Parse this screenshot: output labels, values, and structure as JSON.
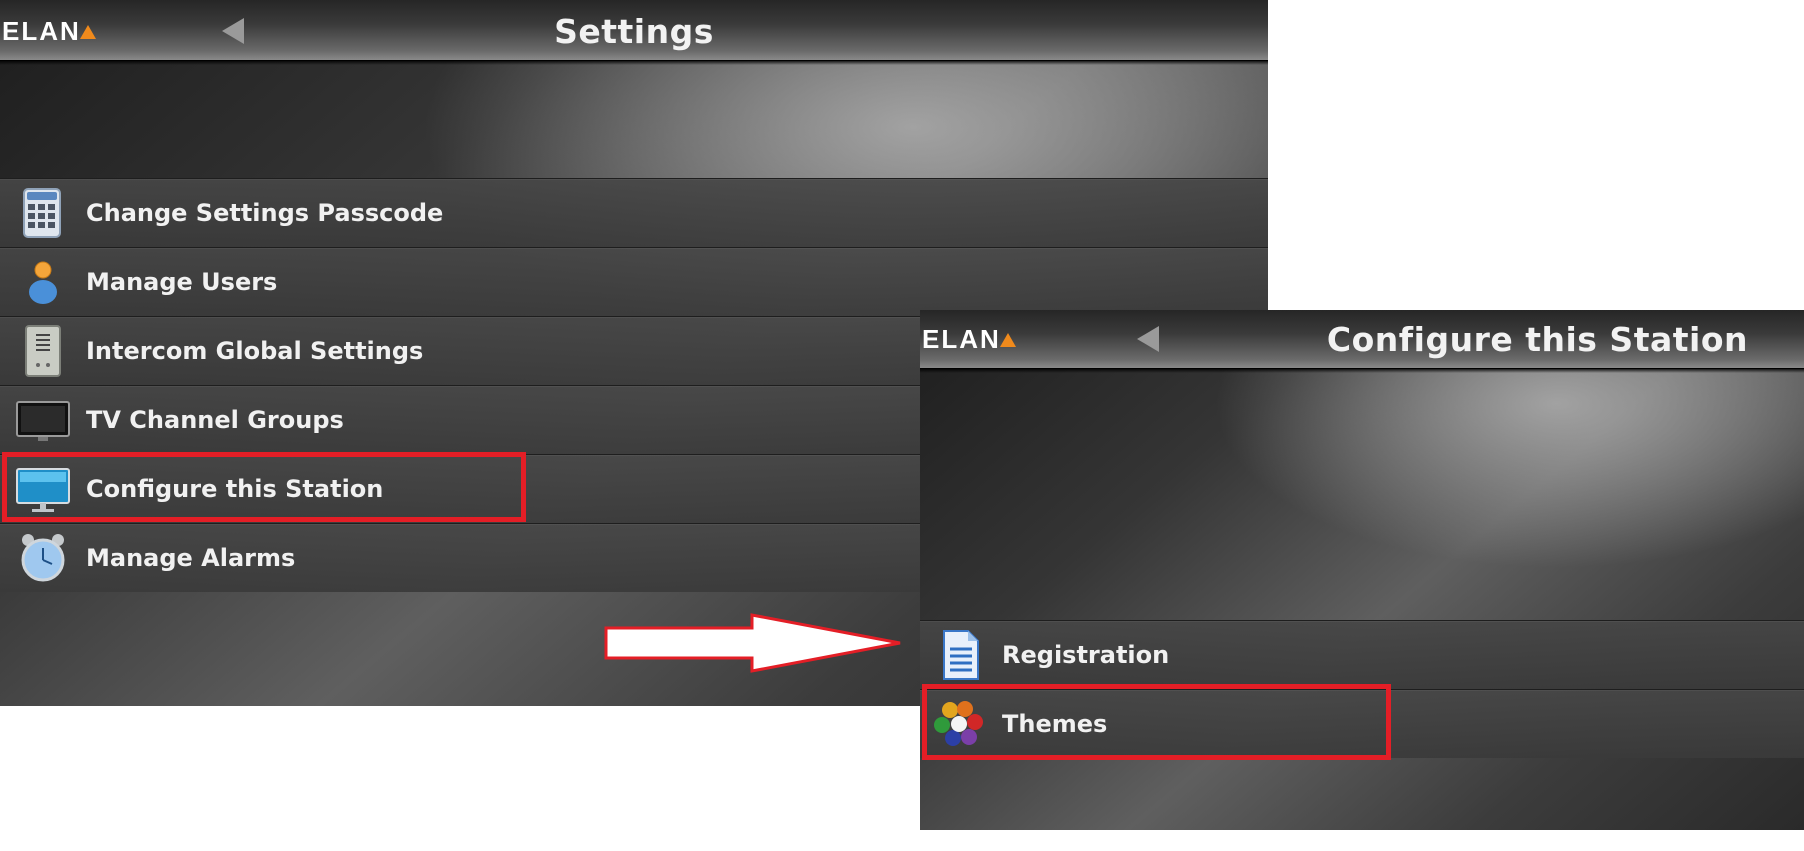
{
  "settings_screen": {
    "logo": "ELAN",
    "title": "Settings",
    "items": [
      {
        "label": "Change Settings Passcode",
        "icon": "keypad-icon"
      },
      {
        "label": "Manage Users",
        "icon": "user-icon"
      },
      {
        "label": "Intercom Global Settings",
        "icon": "intercom-icon"
      },
      {
        "label": "TV Channel Groups",
        "icon": "tv-icon"
      },
      {
        "label": "Configure this Station",
        "icon": "monitor-icon"
      },
      {
        "label": "Manage Alarms",
        "icon": "alarm-clock-icon"
      }
    ],
    "highlighted_item": "Configure this Station"
  },
  "configure_screen": {
    "logo": "ELAN",
    "title": "Configure this Station",
    "items": [
      {
        "label": "Registration",
        "icon": "document-icon"
      },
      {
        "label": "Themes",
        "icon": "color-palette-icon"
      }
    ],
    "highlighted_item": "Themes"
  },
  "colors": {
    "highlight": "#e41e26",
    "logo_accent": "#f08a1c",
    "panel_bg": "#2f2f2f",
    "text": "#f1f1f1"
  }
}
